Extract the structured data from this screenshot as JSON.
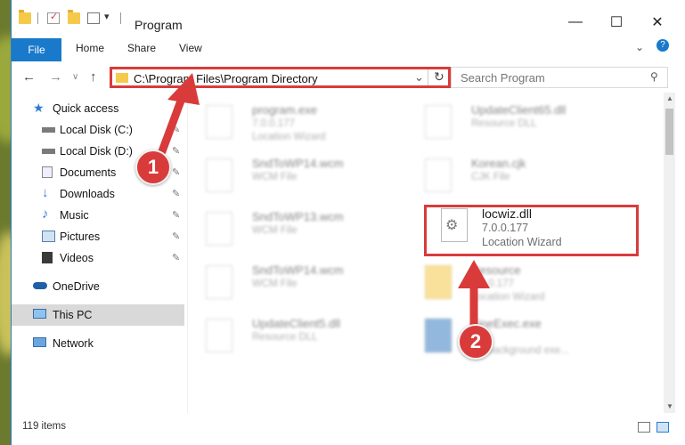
{
  "window": {
    "title": "Program"
  },
  "ribbon": {
    "file_label": "File",
    "tabs": [
      "Home",
      "Share",
      "View"
    ]
  },
  "nav": {
    "address_path": "C:\\Program Files\\Program Directory",
    "search_placeholder": "Search Program"
  },
  "sidebar": {
    "items": [
      {
        "label": "Quick access",
        "icon": "star-icon"
      },
      {
        "label": "Local Disk (C:)",
        "icon": "drive-icon"
      },
      {
        "label": "Local Disk (D:)",
        "icon": "drive-icon"
      },
      {
        "label": "Documents",
        "icon": "documents-icon"
      },
      {
        "label": "Downloads",
        "icon": "download-icon"
      },
      {
        "label": "Music",
        "icon": "music-icon"
      },
      {
        "label": "Pictures",
        "icon": "pictures-icon"
      },
      {
        "label": "Videos",
        "icon": "videos-icon"
      },
      {
        "label": "OneDrive",
        "icon": "cloud-icon"
      },
      {
        "label": "This PC",
        "icon": "monitor-icon"
      },
      {
        "label": "Network",
        "icon": "network-icon"
      }
    ]
  },
  "files": [
    {
      "name": "program.exe",
      "line1": "7.0.0.177",
      "line2": "Location Wizard"
    },
    {
      "name": "UpdateClient65.dll",
      "line1": "Resource DLL",
      "line2": ""
    },
    {
      "name": "SndToWP14.wcm",
      "line1": "WCM File",
      "line2": ""
    },
    {
      "name": "Korean.cjk",
      "line1": "CJK File",
      "line2": ""
    },
    {
      "name": "SndToWP13.wcm",
      "line1": "WCM File",
      "line2": ""
    },
    {
      "name": "locwiz.dll",
      "line1": "7.0.0.177",
      "line2": "Location Wizard"
    },
    {
      "name": "SndToWP14.wcm",
      "line1": "WCM File",
      "line2": ""
    },
    {
      "name": "Resource",
      "line1": "7.0.0.177",
      "line2": "Location Wizard"
    },
    {
      "name": "UpdateClient5.dll",
      "line1": "Resource DLL",
      "line2": ""
    },
    {
      "name": "FineExec.exe",
      "line1": "",
      "line2": "BY background exe..."
    }
  ],
  "status": {
    "item_count": "119 items"
  },
  "annotations": {
    "badge1": "1",
    "badge2": "2"
  },
  "colors": {
    "accent": "#1979ca",
    "highlight": "#d93b3b"
  }
}
